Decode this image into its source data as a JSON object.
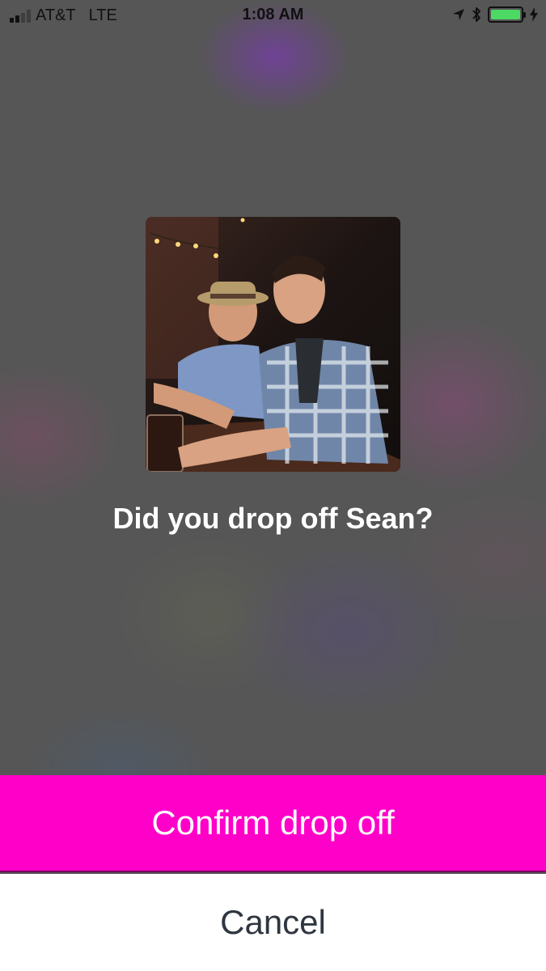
{
  "status_bar": {
    "carrier": "AT&T",
    "network": "LTE",
    "time": "1:08 AM",
    "signal_bars_total": 4,
    "signal_bars_filled": 2,
    "icons": [
      "location-arrow-icon",
      "bluetooth-icon",
      "battery-icon",
      "charging-bolt-icon"
    ],
    "battery_color": "#4cd964"
  },
  "photo": {
    "alt": "profile-photo"
  },
  "prompt": {
    "text": "Did you drop off Sean?"
  },
  "actions": {
    "confirm_label": "Confirm drop off",
    "cancel_label": "Cancel",
    "confirm_color": "#ff00c8"
  }
}
